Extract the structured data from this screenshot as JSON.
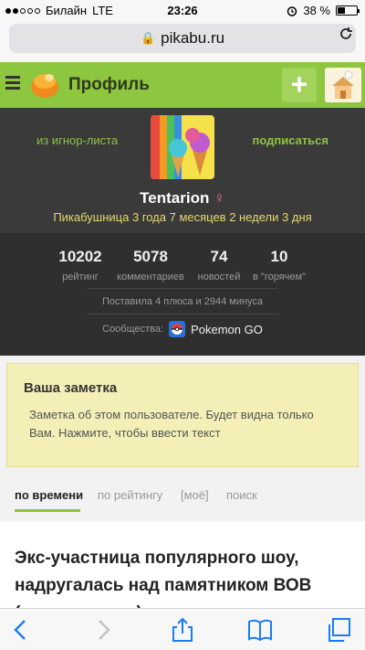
{
  "status_bar": {
    "carrier": "Билайн",
    "network": "LTE",
    "time": "23:26",
    "battery": "38 %",
    "battery_level": 0.38
  },
  "browser": {
    "url": "pikabu.ru"
  },
  "app": {
    "title": "Профиль",
    "accent_color": "#8dc63f"
  },
  "profile": {
    "ignore_label": "из игнор-листа",
    "subscribe_label": "подписаться",
    "username": "Tentarion",
    "gender_symbol": "♀",
    "tenure": "Пикабушница 3 года 7 месяцев 2 недели 3 дня",
    "stats": [
      {
        "value": "10202",
        "label": "рейтинг"
      },
      {
        "value": "5078",
        "label": "комментариев"
      },
      {
        "value": "74",
        "label": "новостей"
      },
      {
        "value": "10",
        "label": "в \"горячем\""
      }
    ],
    "votes": "Поставила 4 плюса и 2944 минуса",
    "communities_label": "Сообщества:",
    "community_name": "Pokemon GO"
  },
  "note": {
    "title": "Ваша заметка",
    "text": "Заметка об этом пользователе. Будет видна только Вам. Нажмите, чтобы ввести текст"
  },
  "tabs": [
    {
      "label": "по времени",
      "active": true
    },
    {
      "label": "по рейтингу",
      "active": false
    },
    {
      "label": "[моё]",
      "active": false
    },
    {
      "label": "поиск",
      "active": false
    }
  ],
  "article": {
    "title": "Экс-участница популярного шоу, надругалась над памятником ВОВ (продолжение)"
  },
  "toolbar_icons": [
    "back-icon",
    "forward-icon",
    "share-icon",
    "bookmarks-icon",
    "tabs-icon"
  ]
}
